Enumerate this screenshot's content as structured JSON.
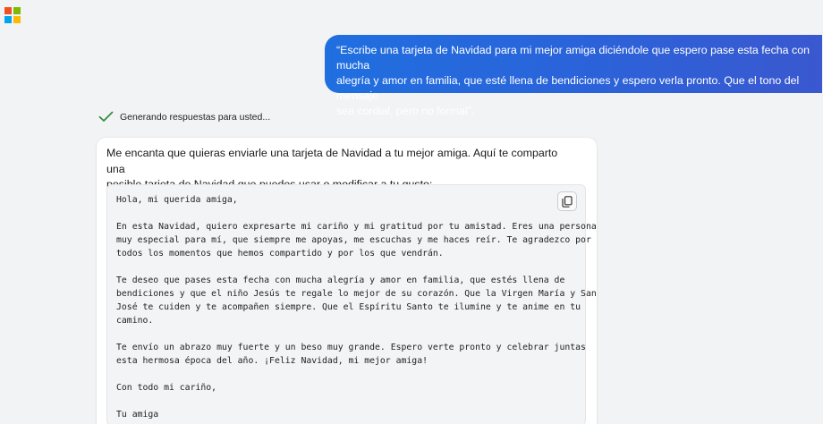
{
  "brand": {
    "logo_colors": [
      "#f25022",
      "#7fba00",
      "#00a4ef",
      "#ffb900"
    ]
  },
  "user_message": {
    "lines": [
      "“Escribe una tarjeta de Navidad para mi mejor amiga diciéndole que espero pase esta fecha con mucha",
      "alegría y amor en familia, que esté llena de bendiciones y espero verla pronto. Que el tono del mensaje",
      "sea cordial, pero no formal”."
    ],
    "bubble_colors": [
      "#1f6fe0",
      "#3a58cf"
    ]
  },
  "status": {
    "text": "Generando respuestas para usted...",
    "icon": "checkmark-icon",
    "icon_color": "#2e8b3a"
  },
  "response": {
    "intro_lines": [
      "Me encanta que quieras enviarle una tarjeta de Navidad a tu mejor amiga. Aquí te comparto una",
      "posible tarjeta de Navidad que puedes usar o modificar a tu gusto:"
    ],
    "copy_icon": "copy-icon",
    "letter": {
      "greeting": "Hola, mi querida amiga,",
      "p1": [
        "En esta Navidad, quiero expresarte mi cariño y mi gratitud por tu amistad. Eres una persona",
        "muy especial para mí, que siempre me apoyas, me escuchas y me haces reír. Te agradezco por",
        "todos los momentos que hemos compartido y por los que vendrán."
      ],
      "p2": [
        "Te deseo que pases esta fecha con mucha alegría y amor en familia, que estés llena de",
        "bendiciones y que el niño Jesús te regale lo mejor de su corazón. Que la Virgen María y San",
        "José te cuiden y te acompañen siempre. Que el Espíritu Santo te ilumine y te anime en tu",
        "camino."
      ],
      "p3": [
        "Te envío un abrazo muy fuerte y un beso muy grande. Espero verte pronto y celebrar juntas",
        "esta hermosa época del año. ¡Feliz Navidad, mi mejor amiga!"
      ],
      "closing": "Con todo mi cariño,",
      "signature": "Tu amiga"
    }
  }
}
